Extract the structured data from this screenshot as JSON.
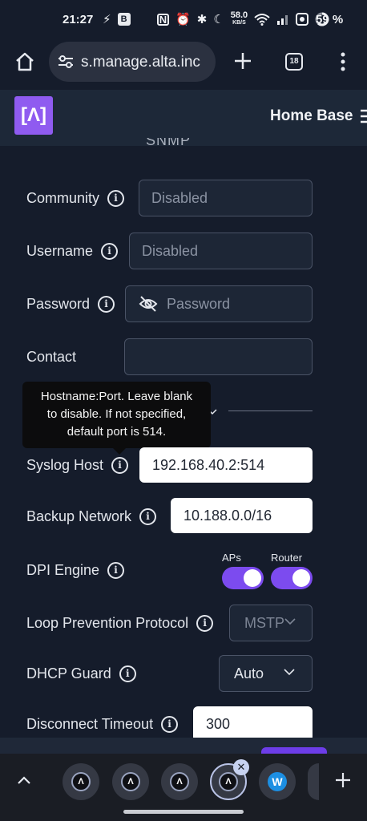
{
  "status_bar": {
    "time": "21:27",
    "net_speed": "58.0",
    "net_unit": "KB/S",
    "battery": "59 %",
    "badge": "B"
  },
  "browser": {
    "url": "s.manage.alta.inc",
    "tab_count": "18"
  },
  "app": {
    "logo": "[Λ]",
    "site_name": "Home Base"
  },
  "section": {
    "title": "SNMP"
  },
  "form": {
    "community": {
      "label": "Community",
      "placeholder": "Disabled"
    },
    "username": {
      "label": "Username",
      "placeholder": "Disabled"
    },
    "password": {
      "label": "Password",
      "placeholder": "Password"
    },
    "contact": {
      "label": "Contact",
      "value": ""
    },
    "tooltip": {
      "line1": "Hostname:Port. Leave blank",
      "line2": "to disable. If not specified,",
      "line3": "default port is 514."
    },
    "syslog_host": {
      "label": "Syslog Host",
      "value": "192.168.40.2:514"
    },
    "backup_network": {
      "label": "Backup Network",
      "value": "10.188.0.0/16"
    },
    "dpi_engine": {
      "label": "DPI Engine",
      "aps_label": "APs",
      "router_label": "Router"
    },
    "loop_prevention": {
      "label": "Loop Prevention Protocol",
      "value": "MSTP"
    },
    "dhcp_guard": {
      "label": "DHCP Guard",
      "value": "Auto"
    },
    "disconnect_timeout": {
      "label": "Disconnect Timeout",
      "value": "300"
    }
  },
  "tabstrip": {
    "tab_glyph": "Λ",
    "w_glyph": "W"
  },
  "colors": {
    "accent": "#7c4bef",
    "background": "#151c2b",
    "header": "#1d2838"
  }
}
